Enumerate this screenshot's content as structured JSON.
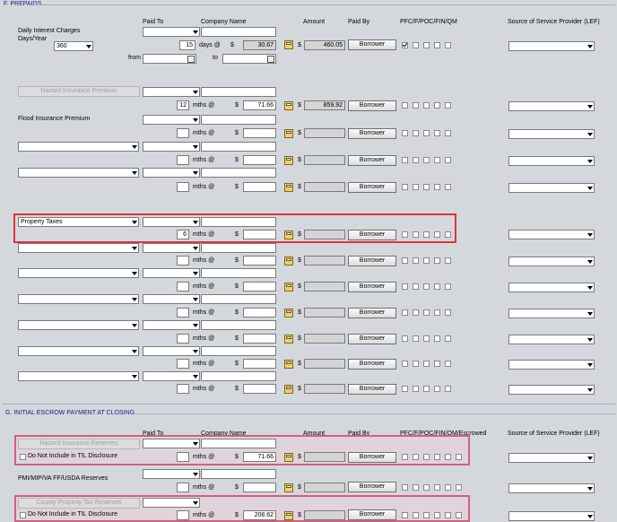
{
  "sectionF": {
    "title": "F. PREPAIDS",
    "headers": {
      "paid_to": "Paid To",
      "company_name": "Company Name",
      "amount": "Amount",
      "paid_by": "Paid By",
      "pfc": "PFC/F/POC/FIN/QM",
      "source": "Source of Service Provider (LEF)"
    },
    "daily_interest": {
      "label1": "Daily Interest Charges",
      "label2": "Days/Year",
      "days_year": "360",
      "days": "15",
      "days_label": "days @",
      "rate": "30.67",
      "amount": "460.05",
      "paid_by": "Borrower",
      "from_label": "from",
      "to_label": "to"
    },
    "hazard": {
      "label": "Hazard Insurance Premium",
      "months": "12",
      "mths_label": "mths @",
      "rate": "71.66",
      "amount": "859.92",
      "paid_by": "Borrower"
    },
    "flood": {
      "label": "Flood Insurance Premium",
      "mths_label": "mths @",
      "paid_by": "Borrower"
    },
    "blank_row_mths": "mths @",
    "property_taxes": {
      "label": "Property Taxes",
      "months": "6",
      "mths_label": "mths @",
      "paid_by": "Borrower"
    },
    "borrower": "Borrower",
    "dollar": "$"
  },
  "sectionG": {
    "title": "G. INITIAL ESCROW PAYMENT AT CLOSING",
    "headers": {
      "paid_to": "Paid To",
      "company_name": "Company Name",
      "amount": "Amount",
      "paid_by": "Paid By",
      "pfc": "PFC/F/POC/FIN/QM/Escrowed",
      "source": "Source of Service Provider (LEF)"
    },
    "hazard_reserves": {
      "label": "Hazard Insurance Reserves",
      "til_label": "Do Not Include in TIL Disclosure",
      "mths_label": "mths @",
      "rate": "71.66",
      "paid_by": "Borrower"
    },
    "pmi": {
      "label": "PMI/MIP/VA FF/USDA Reserves",
      "mths_label": "mths @",
      "paid_by": "Borrower"
    },
    "county_tax": {
      "label": "County Property Tax Reserves",
      "til_label": "Do Not Include in TIL Disclosure",
      "mths_label": "mths @",
      "rate": "208.62",
      "paid_by": "Borrower"
    }
  }
}
